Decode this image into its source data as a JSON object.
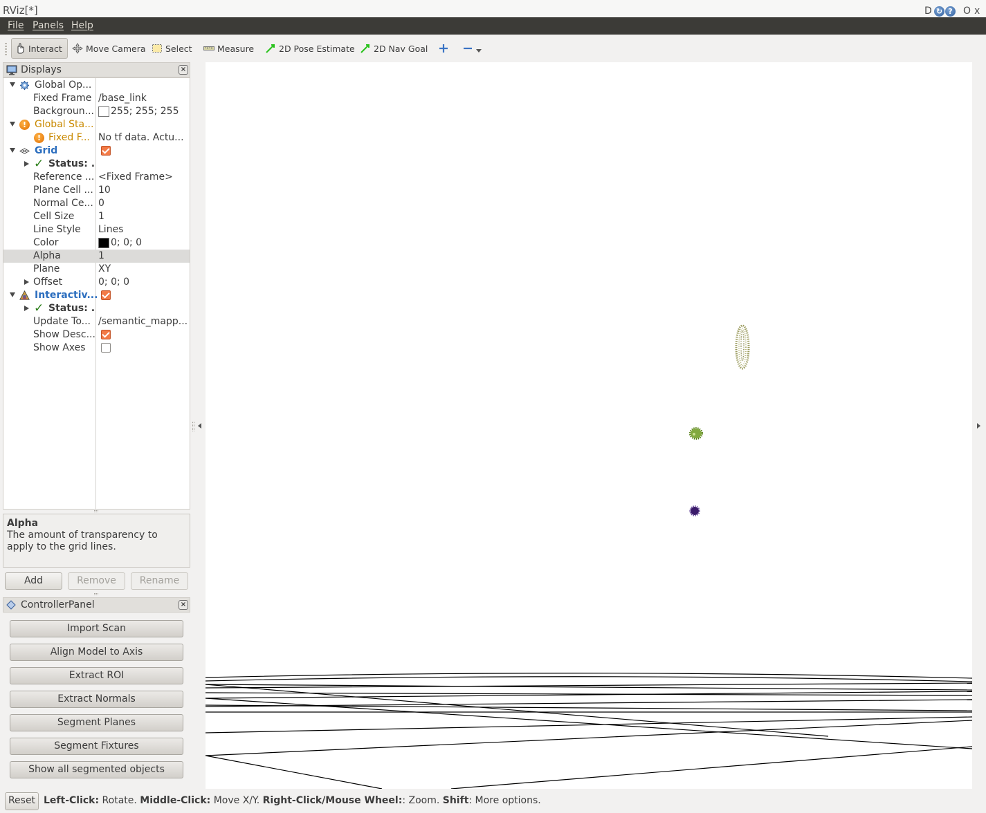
{
  "window": {
    "title": "RViz[*]",
    "controls": [
      "D",
      "O",
      "x"
    ]
  },
  "menubar": {
    "items": [
      "File",
      "Panels",
      "Help"
    ]
  },
  "toolbar": {
    "tools": [
      {
        "label": "Interact",
        "icon": "hand-pointer-icon",
        "active": true
      },
      {
        "label": "Move Camera",
        "icon": "move-camera-icon"
      },
      {
        "label": "Select",
        "icon": "select-rect-icon"
      },
      {
        "label": "Measure",
        "icon": "ruler-icon"
      },
      {
        "label": "2D Pose Estimate",
        "icon": "green-arrow-icon"
      },
      {
        "label": "2D Nav Goal",
        "icon": "green-arrow-icon"
      }
    ],
    "add_icon": "plus-icon",
    "remove_icon": "minus-icon"
  },
  "displays": {
    "title": "Displays",
    "rows": [
      {
        "name": "Global Op...",
        "value": ""
      },
      {
        "name": "Fixed Frame",
        "value": "/base_link"
      },
      {
        "name": "Backgroun...",
        "value": "255; 255; 255"
      },
      {
        "name": "Global Sta...",
        "value": ""
      },
      {
        "name": "Fixed F...",
        "value": "No tf data.  Actu..."
      },
      {
        "name": "Grid",
        "value": ""
      },
      {
        "name": "Status: ...",
        "value": ""
      },
      {
        "name": "Reference ...",
        "value": "<Fixed Frame>"
      },
      {
        "name": "Plane Cell ...",
        "value": "10"
      },
      {
        "name": "Normal Ce...",
        "value": "0"
      },
      {
        "name": "Cell Size",
        "value": "1"
      },
      {
        "name": "Line Style",
        "value": "Lines"
      },
      {
        "name": "Color",
        "value": "0; 0; 0"
      },
      {
        "name": "Alpha",
        "value": "1"
      },
      {
        "name": "Plane",
        "value": "XY"
      },
      {
        "name": "Offset",
        "value": "0; 0; 0"
      },
      {
        "name": "Interactiv...",
        "value": ""
      },
      {
        "name": "Status: ...",
        "value": ""
      },
      {
        "name": "Update To...",
        "value": "/semantic_mapp..."
      },
      {
        "name": "Show Desc...",
        "value": ""
      },
      {
        "name": "Show Axes",
        "value": ""
      }
    ],
    "grid_checked": true,
    "interactive_checked": true,
    "show_desc_checked": true,
    "show_axes_checked": false,
    "selected_row": "Alpha"
  },
  "help": {
    "title": "Alpha",
    "text": "The amount of transparency to apply to the grid lines."
  },
  "display_buttons": {
    "add": "Add",
    "remove": "Remove",
    "rename": "Rename"
  },
  "controller": {
    "title": "ControllerPanel",
    "buttons": [
      "Import Scan",
      "Align Model to Axis",
      "Extract ROI",
      "Extract Normals",
      "Segment Planes",
      "Segment Fixtures",
      "Show all segmented objects"
    ]
  },
  "statusbar": {
    "reset": "Reset",
    "left_click": "Left-Click:",
    "left_click_desc": " Rotate. ",
    "middle_click": "Middle-Click:",
    "middle_click_desc": " Move X/Y. ",
    "right_click": "Right-Click/Mouse Wheel:",
    "right_click_desc": ": Zoom. ",
    "shift": "Shift",
    "shift_desc": ": More options."
  },
  "colors": {
    "menubar_bg": "#3c3b37",
    "accent_orange": "#f37a46",
    "warning_text": "#c98900",
    "link_blue": "#2d6fbf",
    "pointcloud_olive": "#9a9a5c",
    "pointcloud_green": "#5c8a10",
    "pointcloud_purple": "#3a1a6a"
  }
}
